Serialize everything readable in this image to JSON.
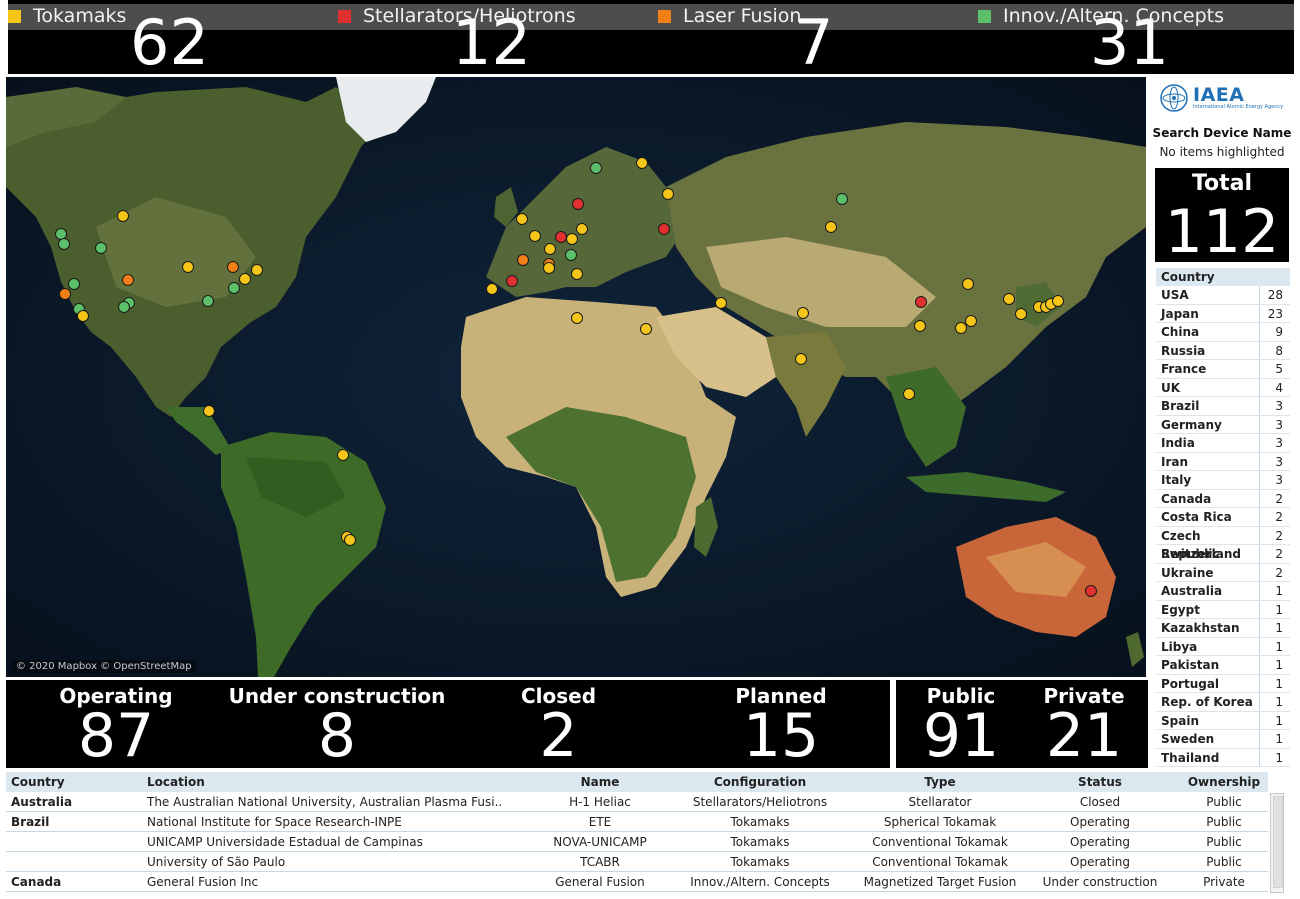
{
  "legend": [
    {
      "label": "Tokamaks",
      "count": "62",
      "color": "#f5c518"
    },
    {
      "label": "Stellarators/Heliotrons",
      "count": "12",
      "color": "#e03030"
    },
    {
      "label": "Laser Fusion",
      "count": "7",
      "color": "#f07f16"
    },
    {
      "label": "Innov./Altern. Concepts",
      "count": "31",
      "color": "#5cbf6a"
    }
  ],
  "map": {
    "attribution": "© 2020 Mapbox © OpenStreetMap",
    "marker_colors": {
      "tokamak": "#f5c518",
      "stellarator": "#e03030",
      "laser": "#f07f16",
      "innov": "#5cbf6a"
    }
  },
  "logo": {
    "text": "IAEA",
    "subtitle": "International Atomic Energy Agency"
  },
  "search": {
    "title": "Search Device Name",
    "status": "No items highlighted"
  },
  "total": {
    "label": "Total",
    "value": "112"
  },
  "country_table": {
    "header": "Country",
    "rows": [
      {
        "name": "USA",
        "value": "28"
      },
      {
        "name": "Japan",
        "value": "23"
      },
      {
        "name": "China",
        "value": "9"
      },
      {
        "name": "Russia",
        "value": "8"
      },
      {
        "name": "France",
        "value": "5"
      },
      {
        "name": "UK",
        "value": "4"
      },
      {
        "name": "Brazil",
        "value": "3"
      },
      {
        "name": "Germany",
        "value": "3"
      },
      {
        "name": "India",
        "value": "3"
      },
      {
        "name": "Iran",
        "value": "3"
      },
      {
        "name": "Italy",
        "value": "3"
      },
      {
        "name": "Canada",
        "value": "2"
      },
      {
        "name": "Costa Rica",
        "value": "2"
      },
      {
        "name": "Czech Republic",
        "value": "2"
      },
      {
        "name": "Switzerland",
        "value": "2"
      },
      {
        "name": "Ukraine",
        "value": "2"
      },
      {
        "name": "Australia",
        "value": "1"
      },
      {
        "name": "Egypt",
        "value": "1"
      },
      {
        "name": "Kazakhstan",
        "value": "1"
      },
      {
        "name": "Libya",
        "value": "1"
      },
      {
        "name": "Pakistan",
        "value": "1"
      },
      {
        "name": "Portugal",
        "value": "1"
      },
      {
        "name": "Rep. of Korea",
        "value": "1"
      },
      {
        "name": "Spain",
        "value": "1"
      },
      {
        "name": "Sweden",
        "value": "1"
      },
      {
        "name": "Thailand",
        "value": "1"
      }
    ]
  },
  "status": [
    {
      "label": "Operating",
      "value": "87"
    },
    {
      "label": "Under construction",
      "value": "8"
    },
    {
      "label": "Closed",
      "value": "2"
    },
    {
      "label": "Planned",
      "value": "15"
    }
  ],
  "ownership": [
    {
      "label": "Public",
      "value": "91"
    },
    {
      "label": "Private",
      "value": "21"
    }
  ],
  "device_table": {
    "headers": [
      "Country",
      "Location",
      "Name",
      "Configuration",
      "Type",
      "Status",
      "Ownership"
    ],
    "rows": [
      [
        "Australia",
        "The Australian National University, Australian Plasma Fusi..",
        "H-1 Heliac",
        "Stellarators/Heliotrons",
        "Stellarator",
        "Closed",
        "Public"
      ],
      [
        "Brazil",
        "National Institute for Space Research-INPE",
        "ETE",
        "Tokamaks",
        "Spherical Tokamak",
        "Operating",
        "Public"
      ],
      [
        "",
        "UNICAMP Universidade Estadual de Campinas",
        "NOVA-UNICAMP",
        "Tokamaks",
        "Conventional Tokamak",
        "Operating",
        "Public"
      ],
      [
        "",
        "University of São Paulo",
        "TCABR",
        "Tokamaks",
        "Conventional Tokamak",
        "Operating",
        "Public"
      ],
      [
        "Canada",
        "General Fusion Inc",
        "General Fusion",
        "Innov./Altern. Concepts",
        "Magnetized Target Fusion",
        "Under construction",
        "Private"
      ]
    ]
  }
}
